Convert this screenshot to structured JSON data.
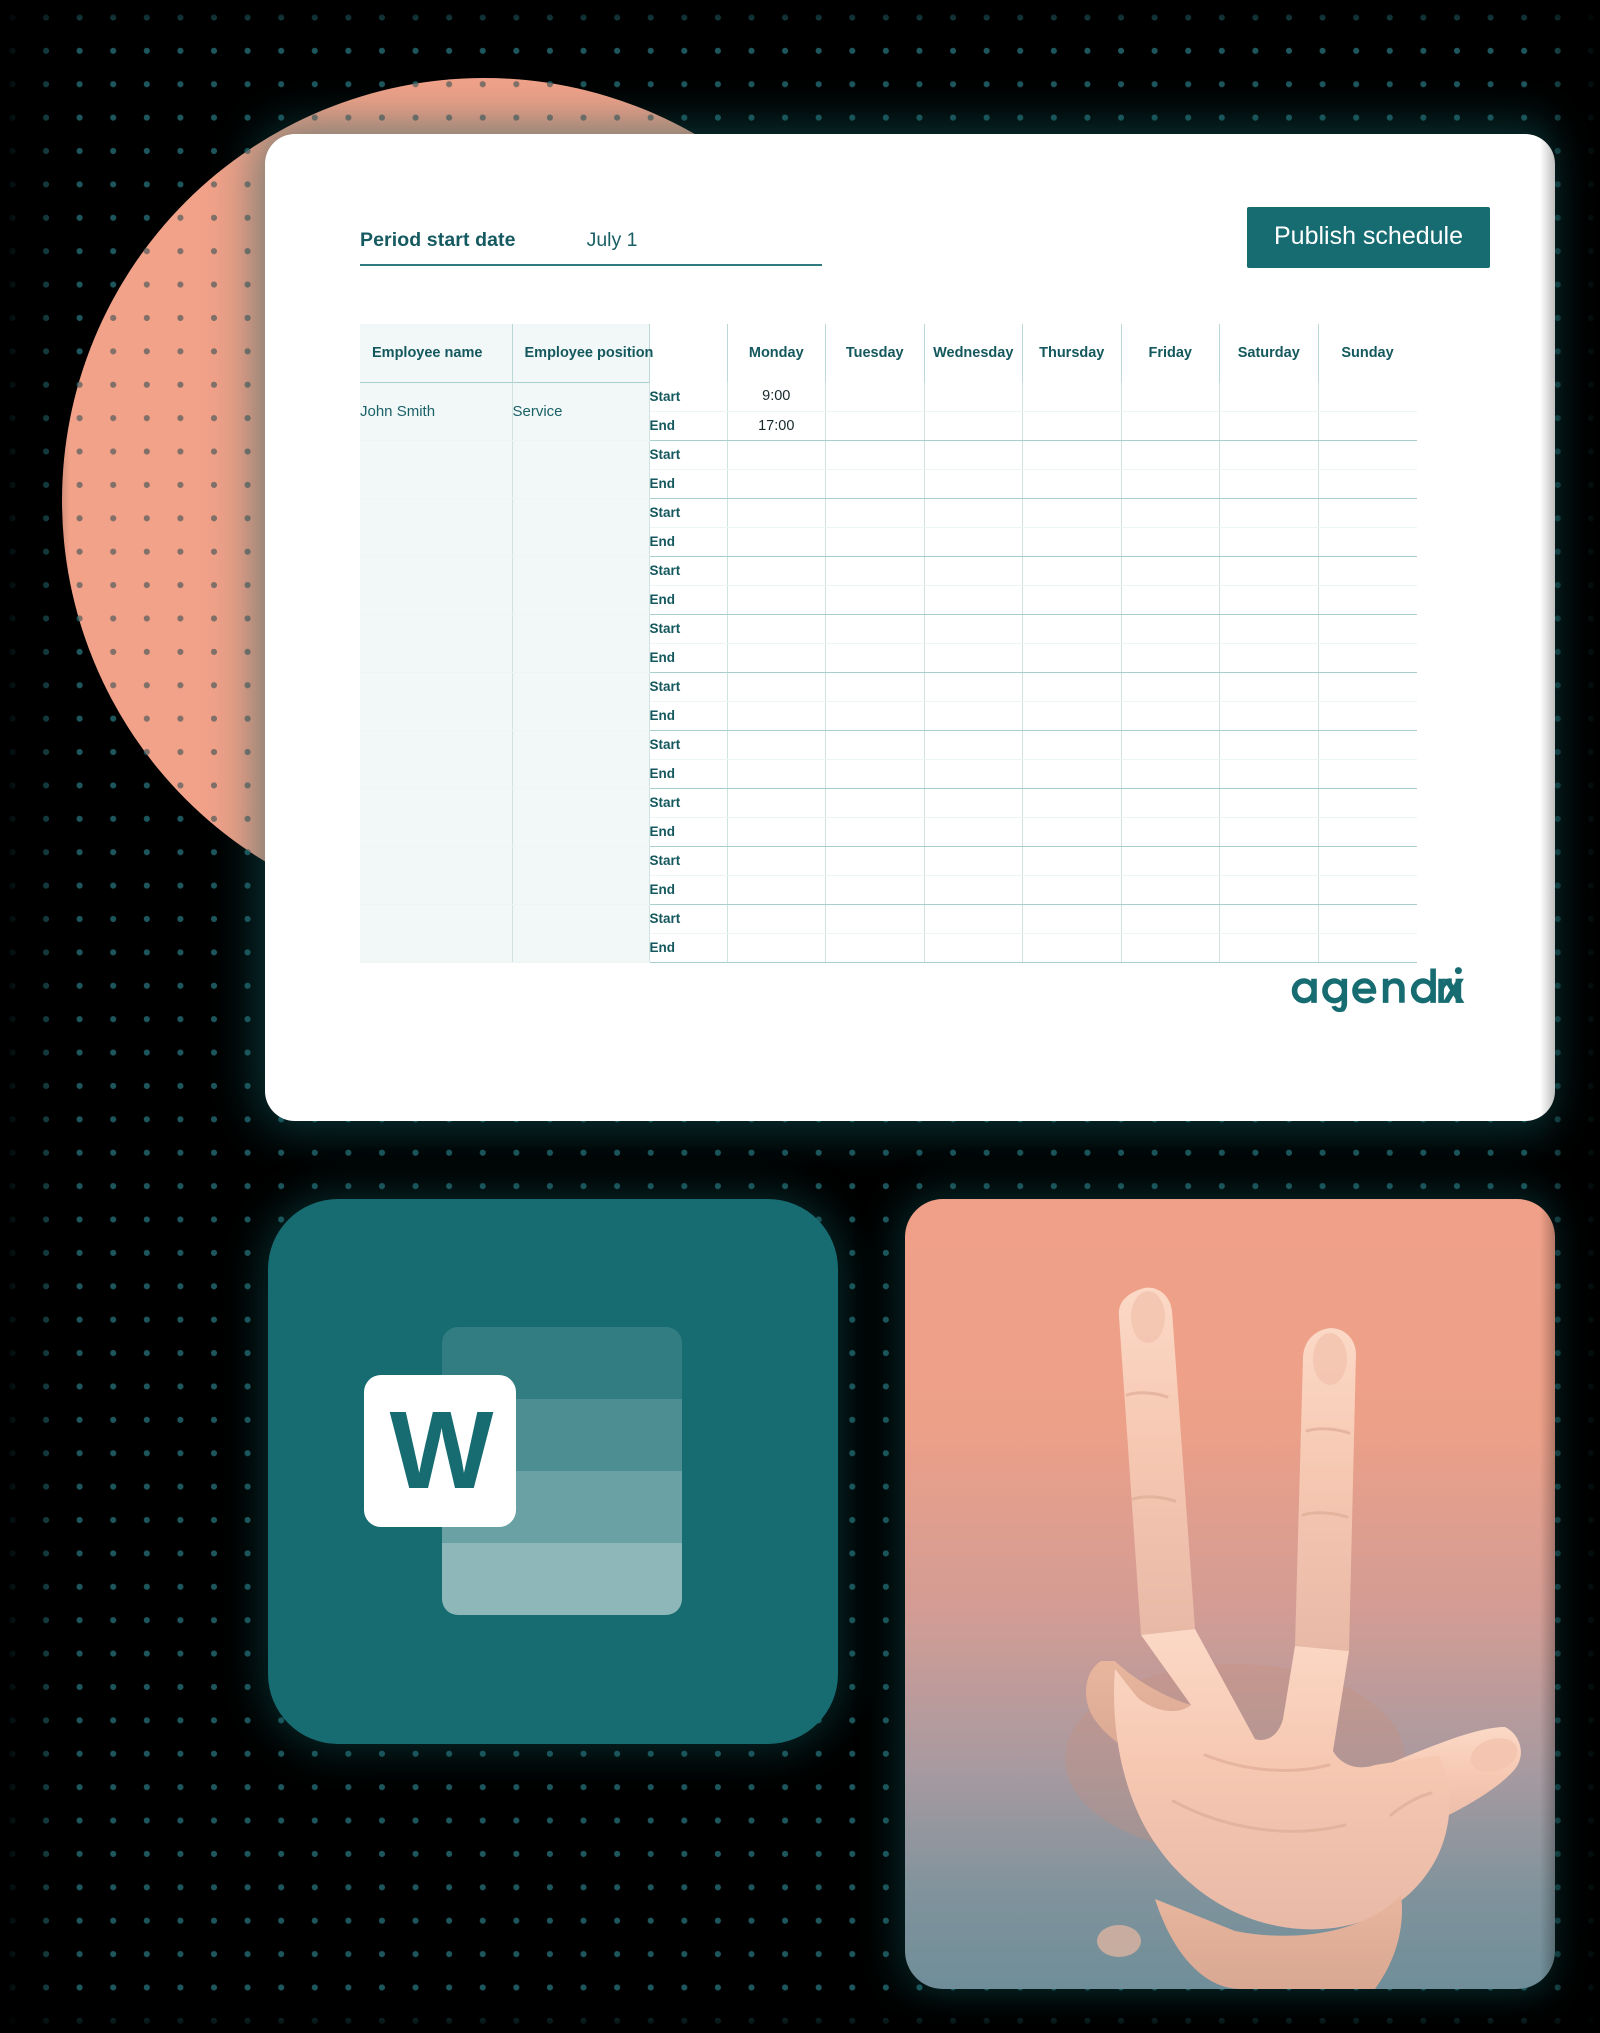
{
  "background": {
    "base_color": "#000000",
    "dot_color": "#1d565c",
    "circle_color": "#f2a289"
  },
  "schedule_card": {
    "period": {
      "label": "Period start date",
      "value": "July 1"
    },
    "publish_button": {
      "label": "Publish schedule",
      "color": "#176c71"
    },
    "table": {
      "headers": {
        "name": "Employee name",
        "position": "Employee position",
        "start_end": "",
        "days": [
          "Monday",
          "Tuesday",
          "Wednesday",
          "Thursday",
          "Friday",
          "Saturday",
          "Sunday"
        ]
      },
      "sub_labels": {
        "start": "Start",
        "end": "End"
      },
      "rows": [
        {
          "name": "John Smith",
          "position": "Service",
          "start": [
            "9:00",
            "",
            "",
            "",
            "",
            "",
            ""
          ],
          "end": [
            "17:00",
            "",
            "",
            "",
            "",
            "",
            ""
          ]
        },
        {
          "name": "",
          "position": "",
          "start": [
            "",
            "",
            "",
            "",
            "",
            "",
            ""
          ],
          "end": [
            "",
            "",
            "",
            "",
            "",
            "",
            ""
          ]
        },
        {
          "name": "",
          "position": "",
          "start": [
            "",
            "",
            "",
            "",
            "",
            "",
            ""
          ],
          "end": [
            "",
            "",
            "",
            "",
            "",
            "",
            ""
          ]
        },
        {
          "name": "",
          "position": "",
          "start": [
            "",
            "",
            "",
            "",
            "",
            "",
            ""
          ],
          "end": [
            "",
            "",
            "",
            "",
            "",
            "",
            ""
          ]
        },
        {
          "name": "",
          "position": "",
          "start": [
            "",
            "",
            "",
            "",
            "",
            "",
            ""
          ],
          "end": [
            "",
            "",
            "",
            "",
            "",
            "",
            ""
          ]
        },
        {
          "name": "",
          "position": "",
          "start": [
            "",
            "",
            "",
            "",
            "",
            "",
            ""
          ],
          "end": [
            "",
            "",
            "",
            "",
            "",
            "",
            ""
          ]
        },
        {
          "name": "",
          "position": "",
          "start": [
            "",
            "",
            "",
            "",
            "",
            "",
            ""
          ],
          "end": [
            "",
            "",
            "",
            "",
            "",
            "",
            ""
          ]
        },
        {
          "name": "",
          "position": "",
          "start": [
            "",
            "",
            "",
            "",
            "",
            "",
            ""
          ],
          "end": [
            "",
            "",
            "",
            "",
            "",
            "",
            ""
          ]
        },
        {
          "name": "",
          "position": "",
          "start": [
            "",
            "",
            "",
            "",
            "",
            "",
            ""
          ],
          "end": [
            "",
            "",
            "",
            "",
            "",
            "",
            ""
          ]
        },
        {
          "name": "",
          "position": "",
          "start": [
            "",
            "",
            "",
            "",
            "",
            "",
            ""
          ],
          "end": [
            "",
            "",
            "",
            "",
            "",
            "",
            ""
          ]
        }
      ]
    },
    "brand": {
      "name": "agendrix",
      "color": "#176c71"
    }
  },
  "tiles": {
    "word": {
      "letter": "W",
      "tile_color": "#176c71",
      "letter_color": "#176c71"
    },
    "hand": {
      "description": "hand showing three fingers",
      "top_color": "#f0a088",
      "bottom_color": "#6f8e99"
    }
  }
}
